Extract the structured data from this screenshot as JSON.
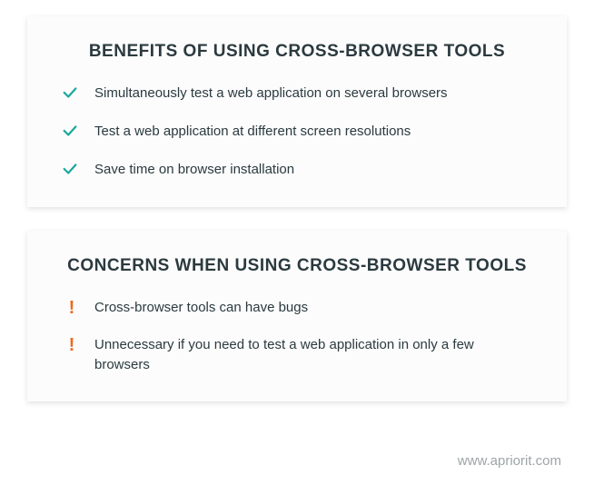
{
  "benefits": {
    "title": "BENEFITS OF USING CROSS-BROWSER TOOLS",
    "items": [
      "Simultaneously test a web application on several browsers",
      "Test a web application at different screen resolutions",
      "Save time on browser installation"
    ]
  },
  "concerns": {
    "title": "CONCERNS WHEN USING CROSS-BROWSER TOOLS",
    "items": [
      "Cross-browser tools can have bugs",
      "Unnecessary if you need to test a web application in only a few browsers"
    ]
  },
  "footer": "www.apriorit.com"
}
